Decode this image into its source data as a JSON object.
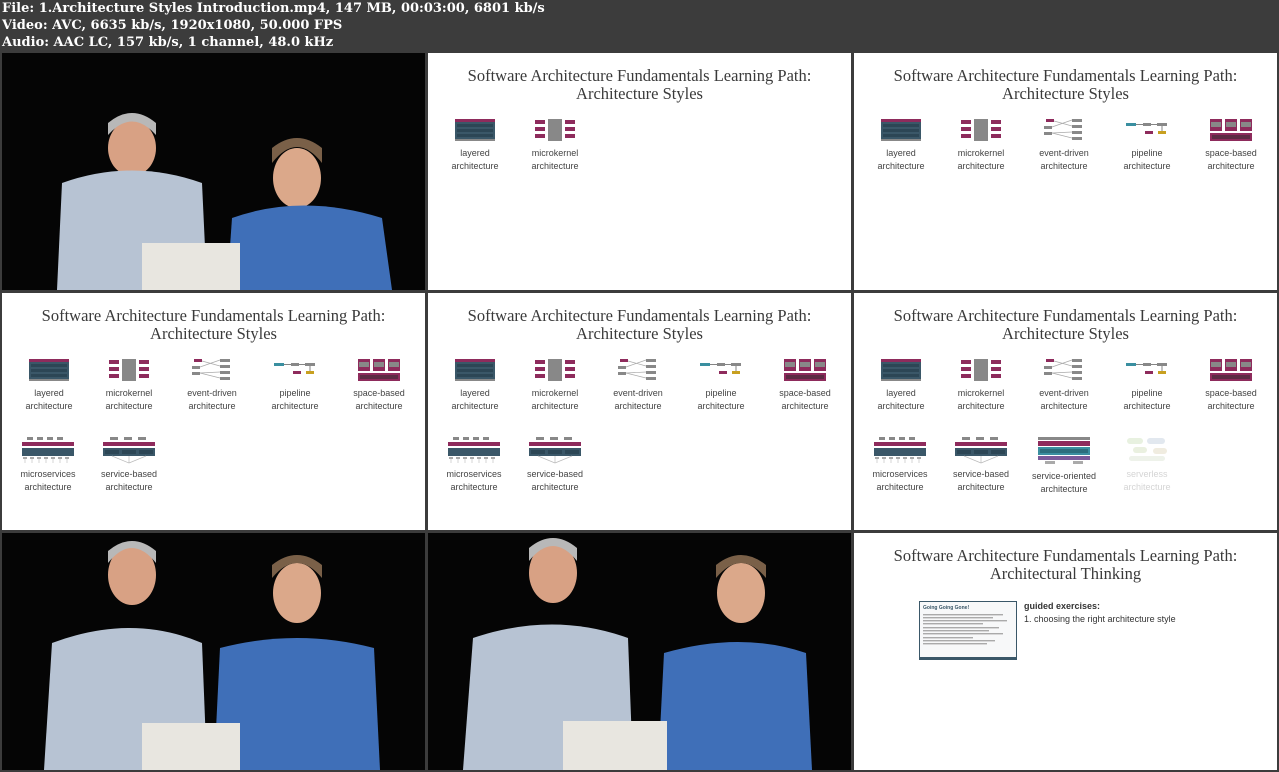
{
  "file_info": {
    "line1": "File: 1.Architecture Styles Introduction.mp4, 147 MB, 00:03:00, 6801 kb/s",
    "line2": "Video: AVC, 6635 kb/s, 1920x1080, 50.000 FPS",
    "line3": "Audio: AAC LC, 157 kb/s, 1 channel, 48.0 kHz"
  },
  "slide": {
    "title_line1": "Software Architecture Fundamentals Learning Path:",
    "title_line2": "Architecture Styles",
    "thinking_title_line2": "Architectural Thinking"
  },
  "styles": {
    "layered": [
      "layered",
      "architecture"
    ],
    "microkernel": [
      "microkernel",
      "architecture"
    ],
    "event_driven": [
      "event-driven",
      "architecture"
    ],
    "pipeline": [
      "pipeline",
      "architecture"
    ],
    "space_based": [
      "space-based",
      "architecture"
    ],
    "microservices": [
      "microservices",
      "architecture"
    ],
    "service_based": [
      "service-based",
      "architecture"
    ],
    "service_oriented": [
      "service-oriented",
      "architecture"
    ],
    "serverless": [
      "serverless",
      "architecture"
    ]
  },
  "thinking": {
    "exercises_heading": "guided exercises:",
    "exercise_1": "1. choosing the right architecture style",
    "doc_title": "Going Going Gone!"
  },
  "colors": {
    "header_bg": "#3c3c3c",
    "slide_bg": "#ffffff",
    "accent_magenta": "#8e2b5c",
    "accent_slate": "#3a5768"
  }
}
